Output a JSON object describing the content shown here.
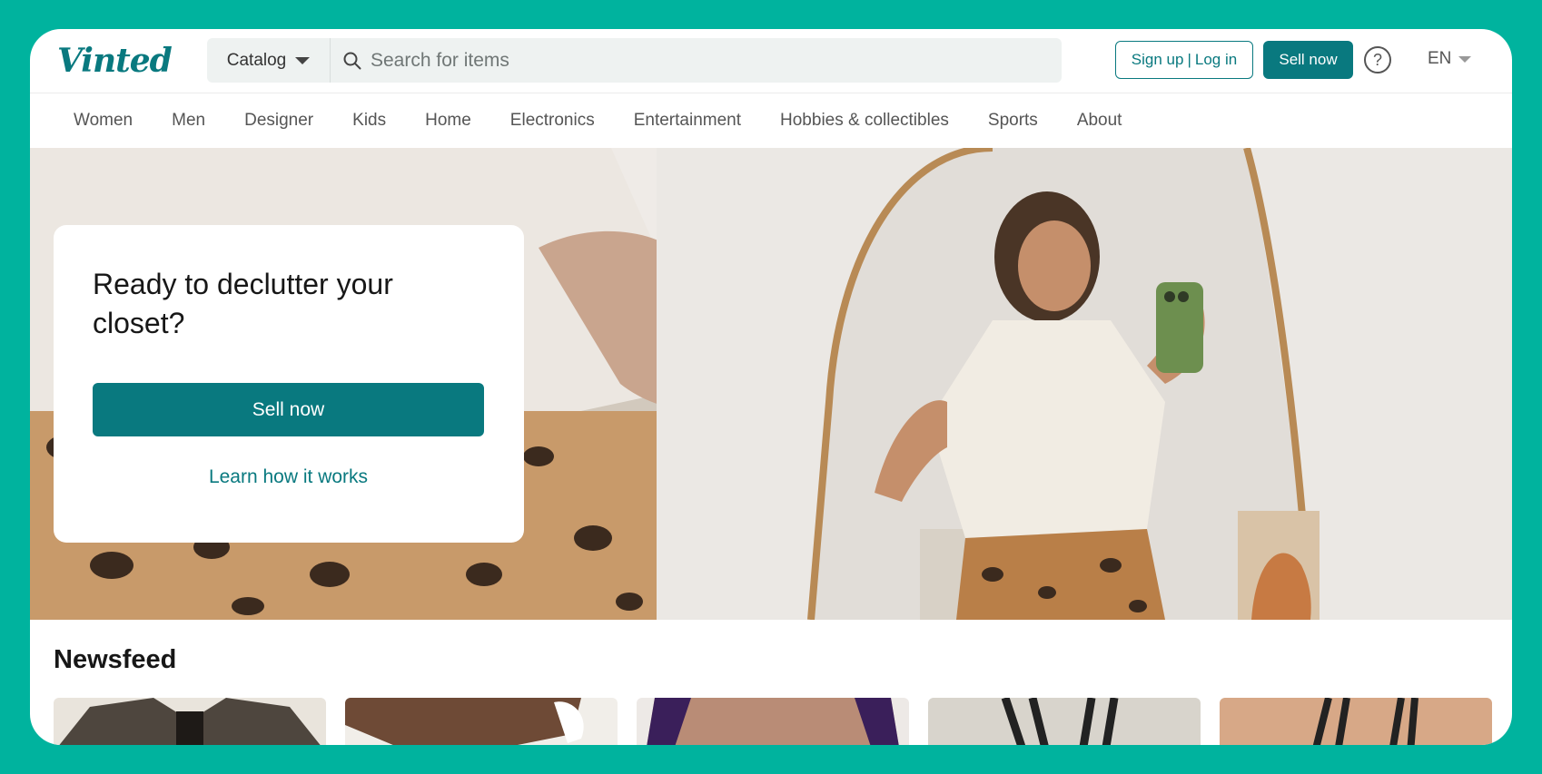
{
  "header": {
    "logo": "Vinted",
    "catalog_label": "Catalog",
    "search_placeholder": "Search for items",
    "signup_label": "Sign up",
    "separator": "|",
    "login_label": "Log in",
    "sell_label": "Sell now",
    "help_glyph": "?",
    "language": "EN"
  },
  "nav": {
    "items": [
      {
        "label": "Women"
      },
      {
        "label": "Men"
      },
      {
        "label": "Designer"
      },
      {
        "label": "Kids"
      },
      {
        "label": "Home"
      },
      {
        "label": "Electronics"
      },
      {
        "label": "Entertainment"
      },
      {
        "label": "Hobbies & collectibles"
      },
      {
        "label": "Sports"
      },
      {
        "label": "About"
      }
    ]
  },
  "hero": {
    "title": "Ready to declutter your closet?",
    "sell_label": "Sell now",
    "learn_label": "Learn how it works"
  },
  "newsfeed": {
    "title": "Newsfeed"
  },
  "colors": {
    "brand": "#09797f",
    "frame_background": "#00b39e"
  },
  "icons": [
    "search-icon",
    "help-icon",
    "chevron-down-icon"
  ]
}
